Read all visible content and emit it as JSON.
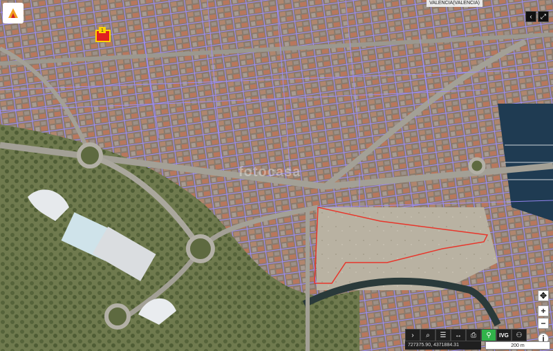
{
  "map": {
    "location_label": "VALENCIA(VALENCIA)",
    "coordinates": "727375.90, 4371884.31",
    "scale_label": "200 m",
    "marker_label": "1",
    "watermark": "fotocasa",
    "colors": {
      "parcel_outline": "#9d8cff",
      "selection_outline": "#e8352a",
      "active_tool": "#31b34a",
      "marker_fill": "#e02020",
      "marker_badge": "#ffd400"
    }
  },
  "controls": {
    "top_right": [
      {
        "name": "collapse-left-icon",
        "glyph": "‹"
      },
      {
        "name": "expand-icon",
        "glyph": "⤢"
      }
    ],
    "zoom": [
      {
        "name": "pan-icon",
        "glyph": "✥"
      },
      {
        "name": "zoom-in-icon",
        "glyph": "+"
      },
      {
        "name": "zoom-out-icon",
        "glyph": "−"
      },
      {
        "name": "info-icon",
        "glyph": "i"
      }
    ],
    "toolbar": [
      {
        "name": "expand-toolbar-icon",
        "glyph": "›"
      },
      {
        "name": "search-icon",
        "glyph": "⌕"
      },
      {
        "name": "layers-icon",
        "glyph": "☰"
      },
      {
        "name": "measure-icon",
        "glyph": "↔"
      },
      {
        "name": "print-icon",
        "glyph": "⎙"
      },
      {
        "name": "location-icon",
        "glyph": "⚲"
      },
      {
        "name": "ivg-button",
        "glyph": "IVG"
      },
      {
        "name": "share-icon",
        "glyph": "⚇"
      }
    ]
  }
}
